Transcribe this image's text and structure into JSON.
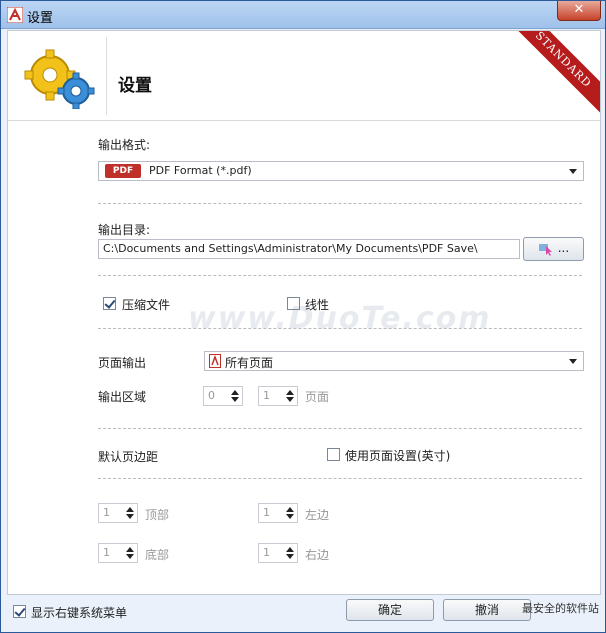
{
  "window": {
    "title": "设置",
    "close_symbol": "✕"
  },
  "header": {
    "title": "设置",
    "ribbon": "STANDARD"
  },
  "output_format": {
    "label": "输出格式:",
    "badge": "PDF",
    "value": "PDF Format (*.pdf)"
  },
  "output_dir": {
    "label": "输出目录:",
    "value": "C:\\Documents and Settings\\Administrator\\My Documents\\PDF Save\\",
    "browse_label": "..."
  },
  "options": {
    "compress_label": "压缩文件",
    "compress_checked": true,
    "linear_label": "线性",
    "linear_checked": false
  },
  "page_output": {
    "label": "页面输出",
    "value": "所有页面"
  },
  "output_range": {
    "label": "输出区域",
    "from": "0",
    "to": "1",
    "unit": "页面"
  },
  "margins": {
    "label": "默认页边距",
    "use_page_setup_label": "使用页面设置(英寸)",
    "use_page_setup_checked": false,
    "top": {
      "value": "1",
      "label": "顶部"
    },
    "left": {
      "value": "1",
      "label": "左边"
    },
    "bottom": {
      "value": "1",
      "label": "底部"
    },
    "right": {
      "value": "1",
      "label": "右边"
    }
  },
  "footer": {
    "context_menu_label": "显示右键系统菜单",
    "context_menu_checked": true,
    "ok_label": "确定",
    "cancel_label": "撤消"
  },
  "watermarks": {
    "center": "www.DuoTe.com",
    "corner": "最安全的软件站"
  },
  "colors": {
    "ribbon": "#b61c1c",
    "pdf_badge": "#c0302a",
    "titlebar": "#9fc1ea"
  }
}
